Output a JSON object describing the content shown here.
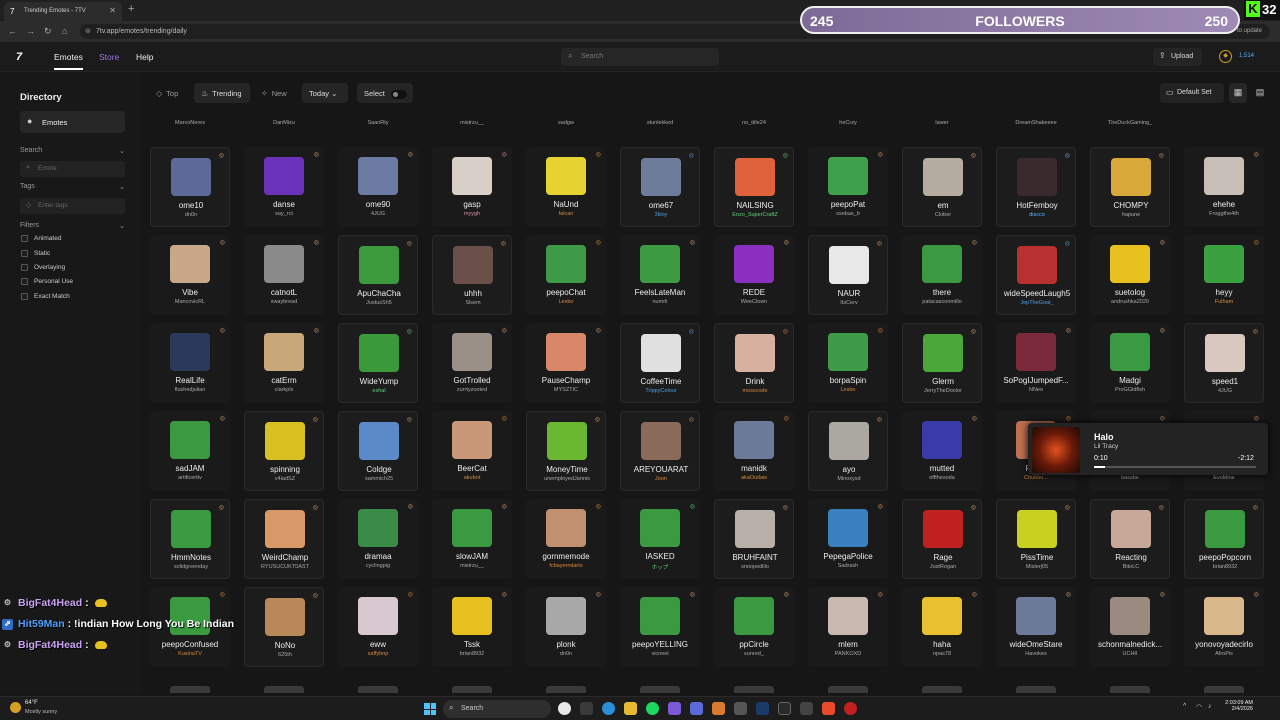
{
  "browser": {
    "tab_title": "Trending Emotes - 7TV",
    "url": "7tv.app/emotes/trending/daily",
    "update_label": "to update"
  },
  "header": {
    "logo": "7",
    "nav": [
      "Emotes",
      "Store",
      "Help"
    ],
    "search_placeholder": "Search",
    "upload_label": "Upload",
    "coin_value": "1,514"
  },
  "sidebar": {
    "title": "Directory",
    "emotes_label": "Emotes",
    "search_label": "Search",
    "emote_placeholder": "Emote",
    "tags_label": "Tags",
    "tags_placeholder": "Enter tags",
    "filters_label": "Filters",
    "filters": [
      "Animated",
      "Static",
      "Overlaying",
      "Personal Use",
      "Exact Match"
    ]
  },
  "toolbar": {
    "top": "Top",
    "trending": "Trending",
    "new": "New",
    "period": "Today",
    "select": "Select",
    "default_set": "Default Set"
  },
  "top_row_authors": [
    "MarcoNeres",
    "DanMizu",
    "SaanRty",
    "mistrzu__",
    "sadgw",
    "stunlekked",
    "no_title24",
    "heCrzy",
    "lawer",
    "DreamShakeeee",
    "TheDuckGaming_",
    "",
    "heCrzy"
  ],
  "rows": [
    [
      {
        "name": "ome10",
        "author": "dn0n",
        "color": "#5b6a98",
        "accent": "",
        "boxed": true
      },
      {
        "name": "danse",
        "author": "say_rct",
        "color": "#6a32b8",
        "accent": "",
        "boxed": false
      },
      {
        "name": "ome90",
        "author": "4JUG",
        "color": "#6b7aa0",
        "accent": "",
        "boxed": false
      },
      {
        "name": "gasp",
        "author": "myygh",
        "color": "#d8d0c8",
        "accent": "#d98fa0",
        "boxed": false
      },
      {
        "name": "NaUnd",
        "author": "falcan",
        "color": "#e6d230",
        "accent": "#d98a3c",
        "boxed": false
      },
      {
        "name": "ome67",
        "author": "3kloy",
        "color": "#6c7c9a",
        "accent": "#4aa0e0",
        "boxed": true
      },
      {
        "name": "NAILSING",
        "author": "Enzo_SuperCraftZ",
        "color": "#e0623a",
        "accent": "#5fd07e",
        "boxed": true
      },
      {
        "name": "peepoPat",
        "author": "ssebas_b",
        "color": "#3ea04a",
        "accent": "",
        "boxed": false
      },
      {
        "name": "em",
        "author": "Clober",
        "color": "#b5aca0",
        "accent": "",
        "boxed": true
      },
      {
        "name": "HotFemboy",
        "author": "discco",
        "color": "#3a2a2e",
        "accent": "#6ab4ff",
        "boxed": true
      },
      {
        "name": "CHOMPY",
        "author": "hapune",
        "color": "#d8a838",
        "accent": "",
        "boxed": true
      },
      {
        "name": "ehehe",
        "author": "Froggthe4th",
        "color": "#c8c0b8",
        "accent": "",
        "boxed": false
      }
    ],
    [
      {
        "name": "Vibe",
        "author": "MancovicRL",
        "color": "#c8a888",
        "accent": "",
        "boxed": false
      },
      {
        "name": "catnotL",
        "author": "swaybread",
        "color": "#8a8a8a",
        "accent": "",
        "boxed": false
      },
      {
        "name": "ApuChaCha",
        "author": "JustusSh5",
        "color": "#3c9a3c",
        "accent": "",
        "boxed": true
      },
      {
        "name": "uhhh",
        "author": "Slsem",
        "color": "#6a5048",
        "accent": "",
        "boxed": true
      },
      {
        "name": "peepoChat",
        "author": "Lesbo",
        "color": "#3e9a46",
        "accent": "#d98a3c",
        "boxed": false
      },
      {
        "name": "FeelsLateMan",
        "author": "numrli",
        "color": "#3c9a40",
        "accent": "",
        "boxed": false
      },
      {
        "name": "REDE",
        "author": "WeeClown",
        "color": "#8a2fc0",
        "accent": "",
        "boxed": false
      },
      {
        "name": "NAUR",
        "author": "ItsCerv",
        "color": "#e8e8e8",
        "accent": "",
        "boxed": true
      },
      {
        "name": "there",
        "author": "patacasconmillo",
        "color": "#3a9a44",
        "accent": "",
        "boxed": false
      },
      {
        "name": "wideSpeedLaugh5",
        "author": "JepTheGoat_",
        "color": "#b83030",
        "accent": "#4aa0e0",
        "boxed": true
      },
      {
        "name": "suetolog",
        "author": "andrushka2020",
        "color": "#e8c020",
        "accent": "",
        "boxed": false
      },
      {
        "name": "heyy",
        "author": "Fulham",
        "color": "#3aa040",
        "accent": "#d98a3c",
        "boxed": false
      }
    ],
    [
      {
        "name": "RealLife",
        "author": "flushedjulian",
        "color": "#2a3a5a",
        "accent": "",
        "boxed": false
      },
      {
        "name": "catErm",
        "author": "clarkpls",
        "color": "#c8a878",
        "accent": "",
        "boxed": false
      },
      {
        "name": "WideYump",
        "author": "eshal",
        "color": "#3a9a3a",
        "accent": "#5fd07e",
        "boxed": true
      },
      {
        "name": "GotTrolled",
        "author": "zurrtyzooted",
        "color": "#9a9088",
        "accent": "",
        "boxed": false
      },
      {
        "name": "PauseChamp",
        "author": "MYSZTIC",
        "color": "#d88868",
        "accent": "",
        "boxed": false
      },
      {
        "name": "CoffeeTime",
        "author": "TrippyColour",
        "color": "#e0e0e0",
        "accent": "#4aa0e0",
        "boxed": true
      },
      {
        "name": "Drink",
        "author": "mosscode",
        "color": "#d8b0a0",
        "accent": "#d98a3c",
        "boxed": true
      },
      {
        "name": "borpaSpin",
        "author": "Lesbo",
        "color": "#3e9a46",
        "accent": "#d98a3c",
        "boxed": false
      },
      {
        "name": "Glerm",
        "author": "JerryTheDoctor",
        "color": "#4aa83a",
        "accent": "",
        "boxed": true
      },
      {
        "name": "SoPogIJumpedF...",
        "author": "NNeo",
        "color": "#7a2a3a",
        "accent": "",
        "boxed": false
      },
      {
        "name": "Madgi",
        "author": "ProGGldfish",
        "color": "#3a9a44",
        "accent": "",
        "boxed": false
      },
      {
        "name": "speed1",
        "author": "4JUG",
        "color": "#d8c8c0",
        "accent": "",
        "boxed": true
      }
    ],
    [
      {
        "name": "sadJAM",
        "author": "artificerttv",
        "color": "#3a9a40",
        "accent": "",
        "boxed": false
      },
      {
        "name": "spinning",
        "author": "v4ladSZ",
        "color": "#d8c020",
        "accent": "",
        "boxed": true
      },
      {
        "name": "Coldge",
        "author": "sammich25",
        "color": "#5a8ac8",
        "accent": "",
        "boxed": true
      },
      {
        "name": "BeerCat",
        "author": "akubot",
        "color": "#c89878",
        "accent": "#d98a3c",
        "boxed": false
      },
      {
        "name": "MoneyTime",
        "author": "unemployedJannis",
        "color": "#6ab830",
        "accent": "",
        "boxed": true
      },
      {
        "name": "AREYOUARAT",
        "author": "Joon",
        "color": "#8a6a58",
        "accent": "#d98a3c",
        "boxed": true
      },
      {
        "name": "manidk",
        "author": "akaOutlaw",
        "color": "#6a7a98",
        "accent": "#d98a3c",
        "boxed": false
      },
      {
        "name": "ayo",
        "author": "Minoxysd",
        "color": "#aaa8a0",
        "accent": "",
        "boxed": true
      },
      {
        "name": "mutted",
        "author": "offthesoda",
        "color": "#3a3aa8",
        "accent": "",
        "boxed": false
      },
      {
        "name": "Pag...",
        "author": "Chubbo...",
        "color": "#c07050",
        "accent": "#d98a3c",
        "boxed": false
      },
      {
        "name": "",
        "author": "bassbe",
        "color": "#1a1a1a",
        "accent": "",
        "boxed": false
      },
      {
        "name": "",
        "author": "EvoMine",
        "color": "#1a1a1a",
        "accent": "",
        "boxed": false
      }
    ],
    [
      {
        "name": "HmmNotes",
        "author": "solidgreenday",
        "color": "#3a9a40",
        "accent": "",
        "boxed": true
      },
      {
        "name": "WeirdChamp",
        "author": "RYUSUCUKT0AST",
        "color": "#d89868",
        "accent": "",
        "boxed": true
      },
      {
        "name": "dramaa",
        "author": "cyclingpig",
        "color": "#3a8a48",
        "accent": "",
        "boxed": false
      },
      {
        "name": "slowJAM",
        "author": "mistrzu__",
        "color": "#3a9a40",
        "accent": "",
        "boxed": false
      },
      {
        "name": "gornmemode",
        "author": "fcbayerndario",
        "color": "#c09070",
        "accent": "#d98a3c",
        "boxed": false
      },
      {
        "name": "IASKED",
        "author": "ホップ",
        "color": "#3a9a40",
        "accent": "#5fd07e",
        "boxed": false
      },
      {
        "name": "BRUHFAINT",
        "author": "snoopedillo",
        "color": "#b8b0a8",
        "accent": "",
        "boxed": true
      },
      {
        "name": "PepegaPolice",
        "author": "Sadrash",
        "color": "#3a80c0",
        "accent": "",
        "boxed": false
      },
      {
        "name": "Rage",
        "author": "JustRogan",
        "color": "#c02020",
        "accent": "",
        "boxed": true
      },
      {
        "name": "PissTime",
        "author": "Misterj05",
        "color": "#c8d020",
        "accent": "",
        "boxed": true
      },
      {
        "name": "Reacting",
        "author": "BitoLC",
        "color": "#c8a898",
        "accent": "",
        "boxed": true
      },
      {
        "name": "peepoPopcorn",
        "author": "brian8932",
        "color": "#3a9a40",
        "accent": "",
        "boxed": true
      }
    ],
    [
      {
        "name": "peepoConfused",
        "author": "KusinaTV",
        "color": "#3a9a40",
        "accent": "#d98a3c",
        "boxed": false
      },
      {
        "name": "NoNo",
        "author": "625th",
        "color": "#b88858",
        "accent": "",
        "boxed": true
      },
      {
        "name": "eww",
        "author": "saffybnp",
        "color": "#d8c8d0",
        "accent": "#d98a3c",
        "boxed": false
      },
      {
        "name": "Tssk",
        "author": "brian8932",
        "color": "#e8c020",
        "accent": "",
        "boxed": false
      },
      {
        "name": "plonk",
        "author": "dn0n",
        "color": "#a8a8a8",
        "accent": "",
        "boxed": false
      },
      {
        "name": "peepoYELLING",
        "author": "vicneel",
        "color": "#3a9a40",
        "accent": "",
        "boxed": false
      },
      {
        "name": "ppCircle",
        "author": "sunred_",
        "color": "#3a9a40",
        "accent": "",
        "boxed": false
      },
      {
        "name": "mlem",
        "author": "PANKOXD",
        "color": "#c8b8b0",
        "accent": "",
        "boxed": false
      },
      {
        "name": "haha",
        "author": "npas78",
        "color": "#e8c030",
        "accent": "",
        "boxed": false
      },
      {
        "name": "wideOmeStare",
        "author": "Havokes",
        "color": "#6a7a98",
        "accent": "",
        "boxed": false
      },
      {
        "name": "schonmalnedick...",
        "author": "UCHII",
        "color": "#9a8a80",
        "accent": "",
        "boxed": false
      },
      {
        "name": "yonovoyadecirlo",
        "author": "AfroPis",
        "color": "#d8b888",
        "accent": "",
        "boxed": false
      }
    ]
  ],
  "overlay": {
    "followers_left": "245",
    "followers_label": "FOLLOWERS",
    "followers_right": "250",
    "kick_count": "32",
    "music_title": "Halo",
    "music_artist": "Lil Tracy",
    "music_elapsed": "0:10",
    "music_remaining": "-2:12",
    "music_progress": 0.07,
    "chat": [
      {
        "user": "BigFat4Head",
        "message": "",
        "color": "#c9a3f2",
        "badge": "mod",
        "emote": true
      },
      {
        "user": "Hit59Man",
        "message": "!indian How Long You Be Indian",
        "color": "#4aa0ff",
        "badge": "blue",
        "emote": false
      },
      {
        "user": "BigFat4Head",
        "message": "",
        "color": "#c9a3f2",
        "badge": "mod",
        "emote": true
      }
    ]
  },
  "taskbar": {
    "temperature": "64°F",
    "weather": "Mostly sunny",
    "search": "Search",
    "time": "2:03:09 AM",
    "date": "2/4/2026"
  }
}
